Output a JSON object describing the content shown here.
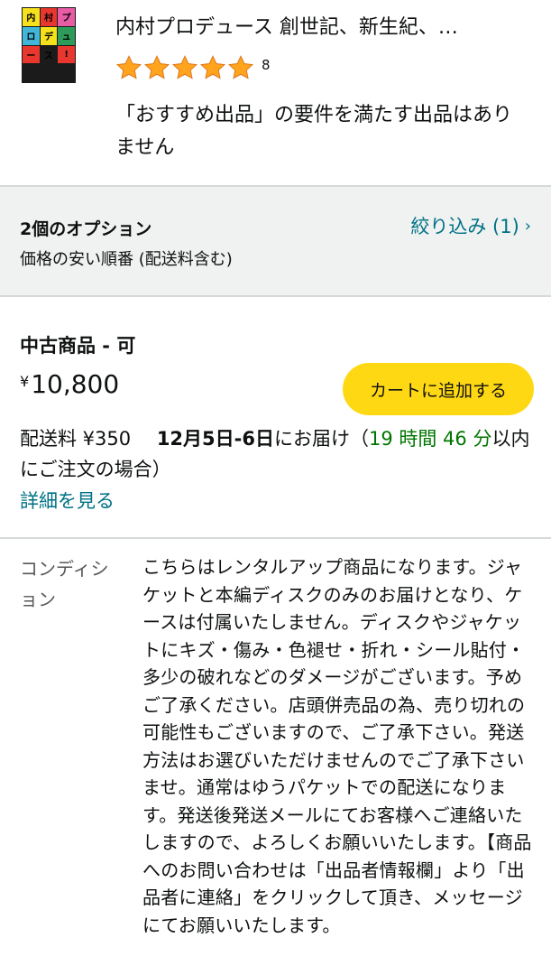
{
  "product": {
    "title": "内村プロデュース 創世記、新生紀、…",
    "rating_count": "8",
    "stars": 5,
    "no_recommended": "「おすすめ出品」の要件を満たす出品はありません",
    "thumb_marks": [
      "内",
      "村",
      "プ",
      "ロ",
      "デ",
      "ュ",
      "ー",
      "ス",
      "!"
    ]
  },
  "options": {
    "count": "2個のオプション",
    "sort": "価格の安い順番 (配送料含む)",
    "filter": "絞り込み (1)",
    "filter_chevron": "›"
  },
  "offer": {
    "condition_title": "中古商品 - 可",
    "currency": "¥",
    "price": "10,800",
    "add_to_cart": "カートに追加する",
    "delivery_fee": "配送料 ¥350",
    "delivery_date": "12月5日-6日",
    "delivery_suffix": "にお届け（",
    "countdown": "19 時間 46 分",
    "countdown_suffix": "以内にご注文の場合）",
    "details": "詳細を見る",
    "condition_label": "コンディション",
    "condition_text": "こちらはレンタルアップ商品になります。ジャケットと本編ディスクのみのお届けとなり、ケースは付属いたしません。ディスクやジャケットにキズ・傷み・色褪せ・折れ・シール貼付・多少の破れなどのダメージがございます。予めご了承ください。店頭併売品の為、売り切れの可能性もございますので、ご了承下さい。発送方法はお選びいただけませんのでご了承下さいませ。通常はゆうパケットでの配送になります。発送後発送メールにてお客様へご連絡いたしますので、よろしくお願いいたします。【商品へのお問い合わせは「出品者情報欄」より「出品者に連絡」をクリックして頂き、メッセージにてお願いいたします。"
  },
  "colors": {
    "star": "#ffa41c",
    "link": "#007185",
    "cart_button": "#ffd814",
    "countdown": "#007600",
    "options_bg": "#f0f2f2"
  }
}
